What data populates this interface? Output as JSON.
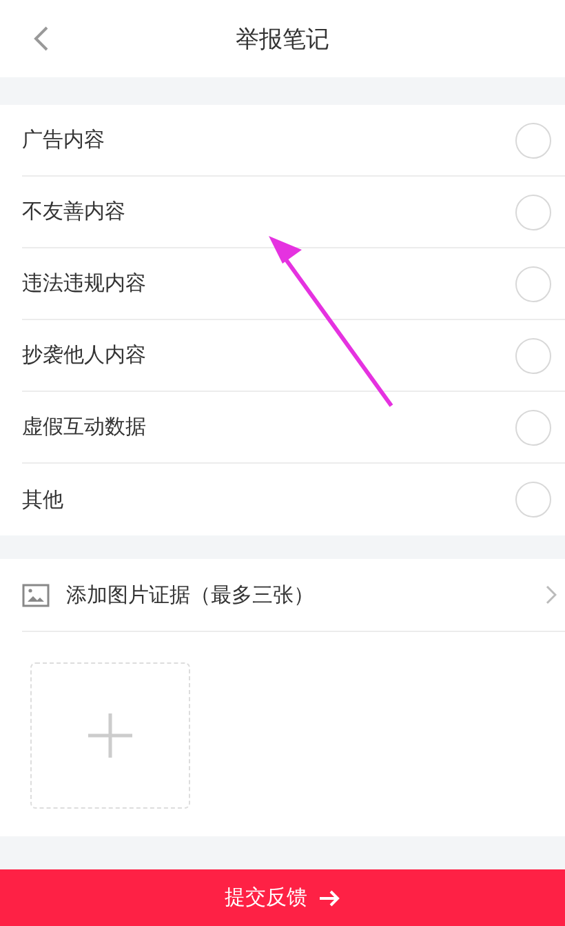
{
  "header": {
    "title": "举报笔记"
  },
  "reasons": [
    {
      "label": "广告内容",
      "selected": false
    },
    {
      "label": "不友善内容",
      "selected": false
    },
    {
      "label": "违法违规内容",
      "selected": false
    },
    {
      "label": "抄袭他人内容",
      "selected": false
    },
    {
      "label": "虚假互动数据",
      "selected": false
    },
    {
      "label": "其他",
      "selected": false
    }
  ],
  "evidence": {
    "label": "添加图片证据（最多三张）"
  },
  "submit": {
    "label": "提交反馈"
  }
}
